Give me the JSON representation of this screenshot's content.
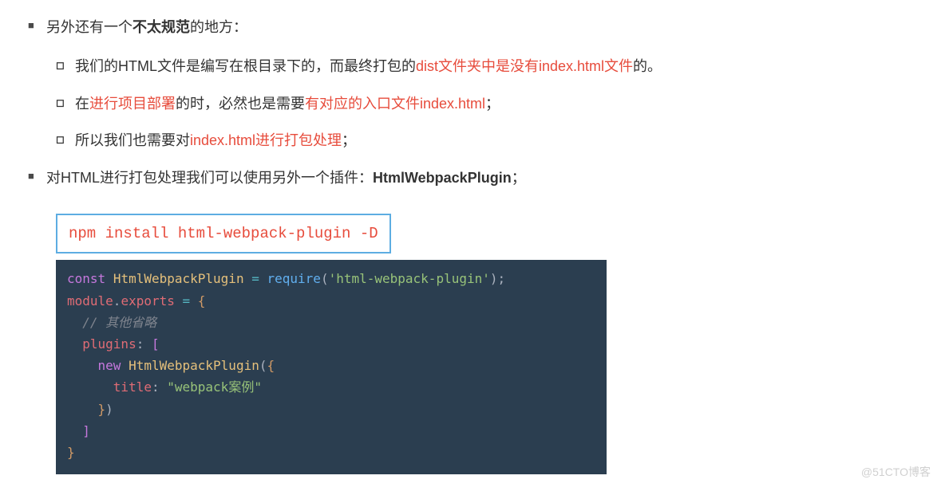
{
  "bullets": {
    "b1_pre": "另外还有一个",
    "b1_bold": "不太规范",
    "b1_post": "的地方：",
    "sub1_pre": "我们的HTML文件是编写在根目录下的，而最终打包的",
    "sub1_red": "dist文件夹中是没有index.html文件",
    "sub1_post": "的。",
    "sub2_t1": "在",
    "sub2_r1": "进行项目部署",
    "sub2_t2": "的时，必然也是需要",
    "sub2_r2": "有对应的入口文件index.html",
    "sub2_t3": "；",
    "sub3_t1": "所以我们也需要对",
    "sub3_r1": "index.html进行打包处理",
    "sub3_t2": "；",
    "b2_pre": "对HTML进行打包处理我们可以使用另外一个插件：",
    "b2_bold": "HtmlWebpackPlugin",
    "b2_post": "；"
  },
  "npm_command": "npm install html-webpack-plugin -D",
  "code": {
    "l1": {
      "kw": "const",
      "sp1": " ",
      "cls": "HtmlWebpackPlugin",
      "sp2": " ",
      "op": "=",
      "sp3": " ",
      "fn": "require",
      "p1": "(",
      "str": "'html-webpack-plugin'",
      "p2": ")",
      "semi": ";"
    },
    "l2": {
      "v1": "module",
      "dot": ".",
      "v2": "exports",
      "sp1": " ",
      "op": "=",
      "sp2": " ",
      "br": "{"
    },
    "l3": {
      "guide": "  ",
      "comment": "// 其他省略"
    },
    "l4": {
      "guide": "  ",
      "prop": "plugins",
      "colon": ":",
      "sp": " ",
      "br": "["
    },
    "l5": {
      "guide": "    ",
      "kw": "new",
      "sp": " ",
      "cls": "HtmlWebpackPlugin",
      "p1": "(",
      "br": "{"
    },
    "l6": {
      "guide": "      ",
      "prop": "title",
      "colon": ":",
      "sp": " ",
      "str": "\"webpack案例\""
    },
    "l7": {
      "guide": "    ",
      "br": "}",
      "p": ")"
    },
    "l8": {
      "guide": "  ",
      "br": "]"
    },
    "l9": {
      "br": "}"
    }
  },
  "watermark": "@51CTO博客"
}
